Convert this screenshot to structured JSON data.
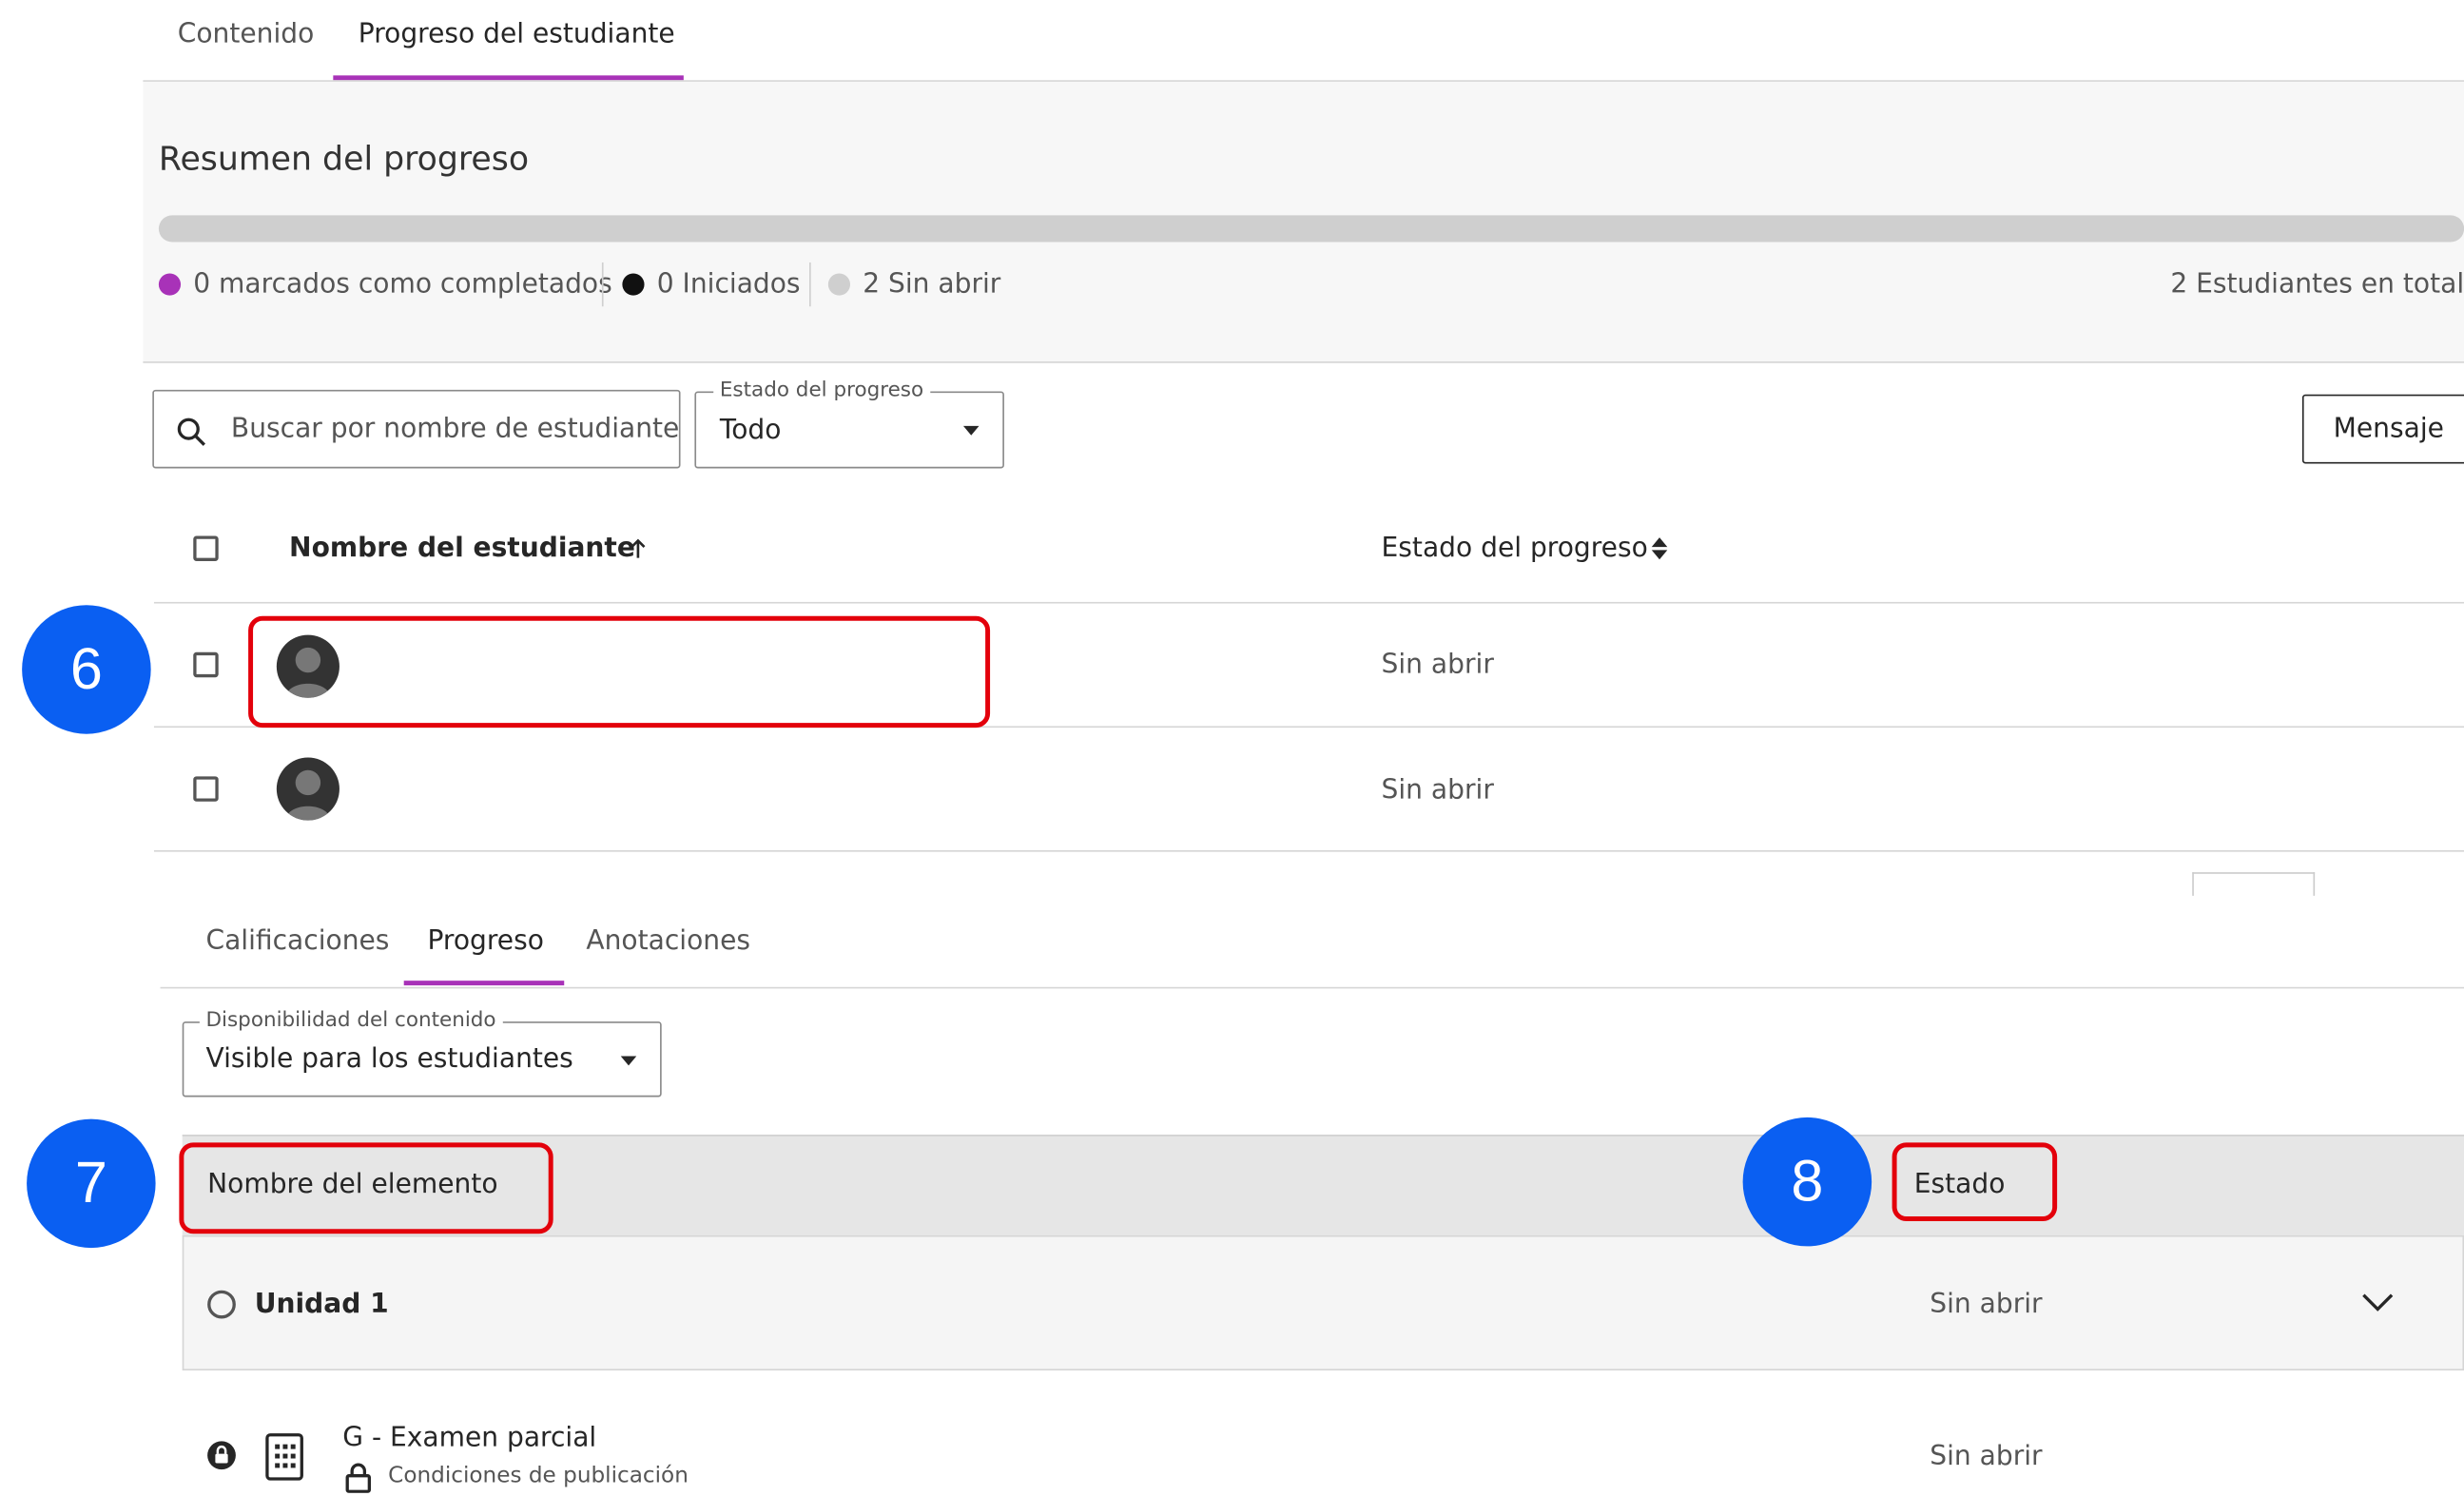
{
  "top_tabs": {
    "content": "Contenido",
    "student_progress": "Progreso del estudiante"
  },
  "summary": {
    "title": "Resumen del progreso",
    "progress_fraction_completed": 0,
    "legend": {
      "completed": "0 marcados como completados",
      "started": "0 Iniciados",
      "unopened": "2 Sin abrir"
    },
    "total": "2 Estudiantes en total"
  },
  "filters": {
    "search_placeholder": "Buscar por nombre de estudiante",
    "status_label": "Estado del progreso",
    "status_value": "Todo",
    "message_button": "Mensaje"
  },
  "students_table": {
    "col_name": "Nombre del estudiante",
    "col_status": "Estado del progreso",
    "rows": [
      {
        "status": "Sin abrir"
      },
      {
        "status": "Sin abrir"
      }
    ]
  },
  "panel_tabs": {
    "grades": "Calificaciones",
    "progress": "Progreso",
    "annotations": "Anotaciones"
  },
  "availability": {
    "label": "Disponibilidad del contenido",
    "value": "Visible para los estudiantes"
  },
  "items_table": {
    "col_name": "Nombre del elemento",
    "col_status": "Estado",
    "rows": [
      {
        "name": "Unidad 1",
        "status": "Sin abrir"
      },
      {
        "name": "G - Examen parcial",
        "sub": "Condiciones de publicación",
        "status": "Sin abrir"
      }
    ]
  },
  "callouts": {
    "c6": "6",
    "c7": "7",
    "c8": "8"
  },
  "colors": {
    "accent": "#a832b8",
    "callout": "#0a5ff2",
    "highlight": "#e3000b"
  }
}
